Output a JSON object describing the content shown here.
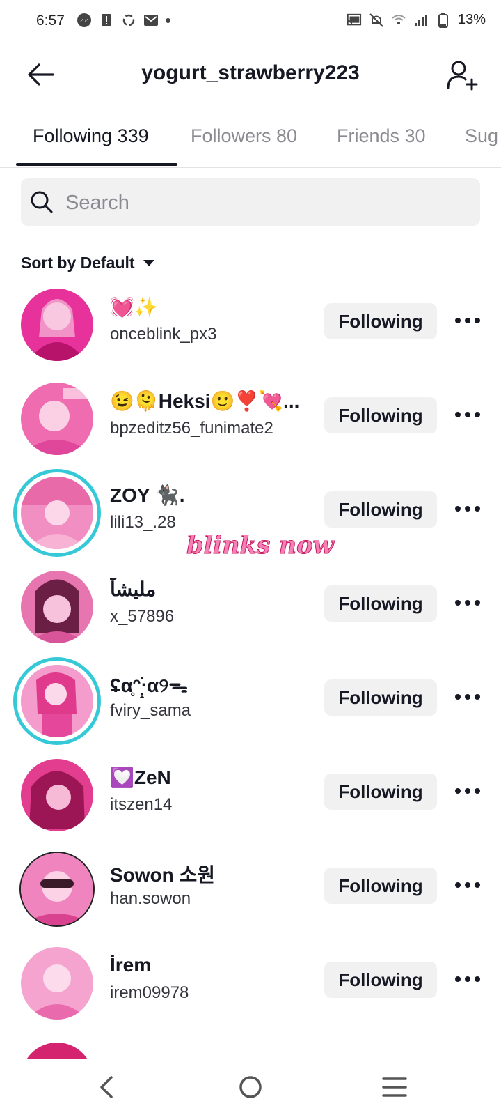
{
  "status_bar": {
    "time": "6:57",
    "battery": "13%"
  },
  "header": {
    "title": "yogurt_strawberry223"
  },
  "tabs": [
    {
      "label": "Following 339",
      "active": true
    },
    {
      "label": "Followers 80",
      "active": false
    },
    {
      "label": "Friends 30",
      "active": false
    },
    {
      "label": "Sug",
      "active": false
    }
  ],
  "search": {
    "placeholder": "Search"
  },
  "sort": {
    "label": "Sort by Default"
  },
  "follow_button_label": "Following",
  "overlay_text": "blinks now",
  "users": [
    {
      "name": "💓✨",
      "handle": "onceblink_px3",
      "ring": false
    },
    {
      "name": "😉🫠Heksi🙂❣️💘...",
      "handle": "bpzeditz56_funimate2",
      "ring": false
    },
    {
      "name": "ZOY 🐈‍⬛.",
      "handle": "lili13_.28",
      "ring": true
    },
    {
      "name": "مليشآ",
      "handle": "x_57896",
      "ring": false
    },
    {
      "name": "ʢα̥ᵔ‧̣̥̇α୨ᯓ",
      "handle": "fviry_sama",
      "ring": true
    },
    {
      "name": "💟ZeN",
      "handle": "itszen14",
      "ring": false
    },
    {
      "name": "Sowon 소원",
      "handle": "han.sowon",
      "ring": false
    },
    {
      "name": "İrem",
      "handle": "irem09978",
      "ring": false
    }
  ],
  "colors": {
    "story_ring": "#35c9d8",
    "avatar_pink": "#e8338a",
    "button_bg": "#f1f1f2"
  }
}
